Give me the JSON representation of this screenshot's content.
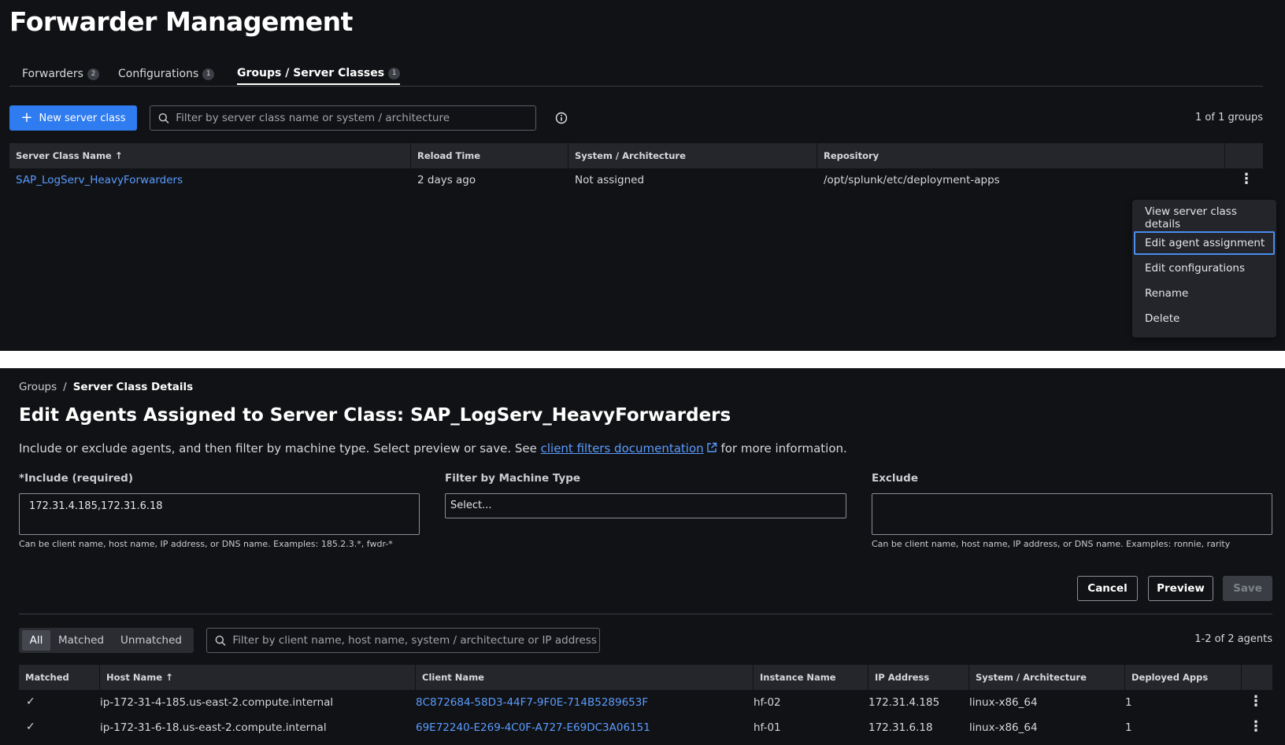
{
  "header": {
    "title": "Forwarder Management"
  },
  "tabs": [
    {
      "label": "Forwarders",
      "count": "2"
    },
    {
      "label": "Configurations",
      "count": "1"
    },
    {
      "label": "Groups / Server Classes",
      "count": "1"
    }
  ],
  "toolbar": {
    "new_label": "New server class",
    "filter_placeholder": "Filter by server class name or system / architecture",
    "count": "1 of 1 groups"
  },
  "groups_table": {
    "columns": [
      "Server Class Name",
      "Reload Time",
      "System / Architecture",
      "Repository"
    ],
    "rows": [
      {
        "name": "SAP_LogServ_HeavyForwarders",
        "reload": "2 days ago",
        "system": "Not assigned",
        "repository": "/opt/splunk/etc/deployment-apps"
      }
    ]
  },
  "row_menu": {
    "items": [
      "View server class details",
      "Edit agent assignment",
      "Edit configurations",
      "Rename",
      "Delete"
    ]
  },
  "breadcrumb": {
    "root": "Groups",
    "separator": "/",
    "current": "Server Class Details"
  },
  "edit": {
    "title": "Edit Agents Assigned to Server Class: SAP_LogServ_HeavyForwarders",
    "desc_before": "Include or exclude agents, and then filter by machine type. Select preview or save. See ",
    "desc_link": "client filters documentation",
    "desc_after": " for more information.",
    "include_required": "*",
    "include_label": "Include (required)",
    "include_value": "172.31.4.185,172.31.6.18",
    "include_help": "Can be client name, host name, IP address, or DNS name. Examples: 185.2.3.*, fwdr-*",
    "machine_label": "Filter by Machine Type",
    "machine_value": "Select...",
    "exclude_label": "Exclude",
    "exclude_value": "",
    "exclude_help": "Can be client name, host name, IP address, or DNS name. Examples: ronnie, rarity",
    "cancel_label": "Cancel",
    "preview_label": "Preview",
    "save_label": "Save"
  },
  "agent_filter": {
    "segments": [
      "All",
      "Matched",
      "Unmatched"
    ],
    "active": "All",
    "placeholder": "Filter by client name, host name, system / architecture or IP address",
    "count": "1-2 of 2 agents"
  },
  "agents_table": {
    "columns": [
      "Matched",
      "Host Name",
      "Client Name",
      "Instance Name",
      "IP Address",
      "System / Architecture",
      "Deployed Apps"
    ],
    "rows": [
      {
        "matched": "✓",
        "host": "ip-172-31-4-185.us-east-2.compute.internal",
        "client": "8C872684-58D3-44F7-9F0E-714B5289653F",
        "instance": "hf-02",
        "ip": "172.31.4.185",
        "system": "linux-x86_64",
        "apps": "1"
      },
      {
        "matched": "✓",
        "host": "ip-172-31-6-18.us-east-2.compute.internal",
        "client": "69E72240-E269-4C0F-A727-E69DC3A06151",
        "instance": "hf-01",
        "ip": "172.31.6.18",
        "system": "linux-x86_64",
        "apps": "1"
      }
    ]
  },
  "icons": {
    "plus": "plus-icon",
    "search": "search-icon",
    "info": "info-icon",
    "sort": "sort-ascending-icon",
    "kebab": "more-vertical-icon",
    "external": "external-link-icon",
    "check": "check-icon"
  },
  "colors": {
    "accent": "#2f7bf0",
    "link": "#5a9cff",
    "background": "#111215"
  }
}
